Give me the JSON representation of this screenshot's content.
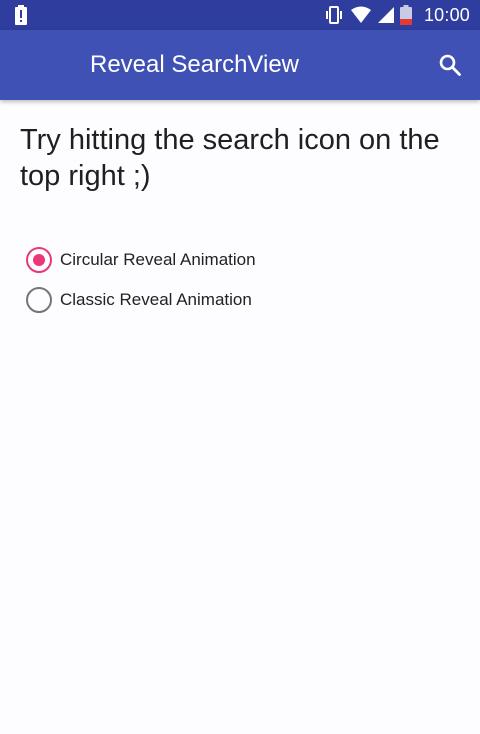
{
  "colors": {
    "status_bar": "#2f3d9e",
    "app_bar": "#3f51b5",
    "accent": "#e8387a",
    "background": "#fdfcfe"
  },
  "status_bar": {
    "left_icon": "battery-alert-icon",
    "icons": [
      "vibrate-icon",
      "wifi-icon",
      "signal-icon",
      "battery-icon"
    ],
    "time": "10:00"
  },
  "app_bar": {
    "title": "Reveal SearchView",
    "action_icon": "search-icon"
  },
  "main": {
    "headline": "Try hitting the search icon on the top right ;)",
    "options": [
      {
        "label": "Circular Reveal Animation",
        "checked": true
      },
      {
        "label": "Classic Reveal Animation",
        "checked": false
      }
    ]
  }
}
